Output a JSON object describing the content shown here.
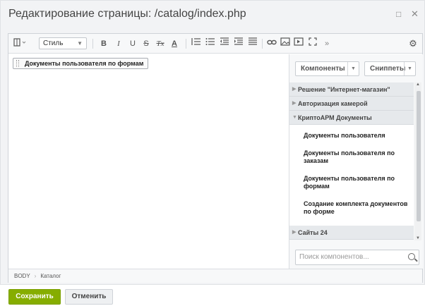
{
  "dialog": {
    "title": "Редактирование страницы: /catalog/index.php",
    "maximize_icon": "□",
    "close_icon": "✕"
  },
  "toolbar": {
    "style_label": "Стиль",
    "bold": "B",
    "italic": "I",
    "underline": "U",
    "strike": "S",
    "remove_format": "Tx",
    "font_color": "A",
    "more": "»",
    "settings_icon": "⚙"
  },
  "content": {
    "component_chip": "Документы пользователя по формам"
  },
  "panel": {
    "tab_components": "Компоненты",
    "tab_snippets": "Сниппеты",
    "groups": [
      {
        "label": "Решение \"Интернет-магазин\"",
        "open": false
      },
      {
        "label": "Авторизация камерой",
        "open": false
      },
      {
        "label": "КриптоАРМ Документы",
        "open": true
      }
    ],
    "items": [
      "Документы пользователя",
      "Документы пользователя по заказам",
      "Документы пользователя по формам",
      "Создание комплекта документов по форме"
    ],
    "group_after": "Сайты 24",
    "search_placeholder": "Поиск компонентов..."
  },
  "statusbar": {
    "path": [
      "BODY",
      "Каталог"
    ]
  },
  "footer": {
    "save": "Сохранить",
    "cancel": "Отменить"
  }
}
